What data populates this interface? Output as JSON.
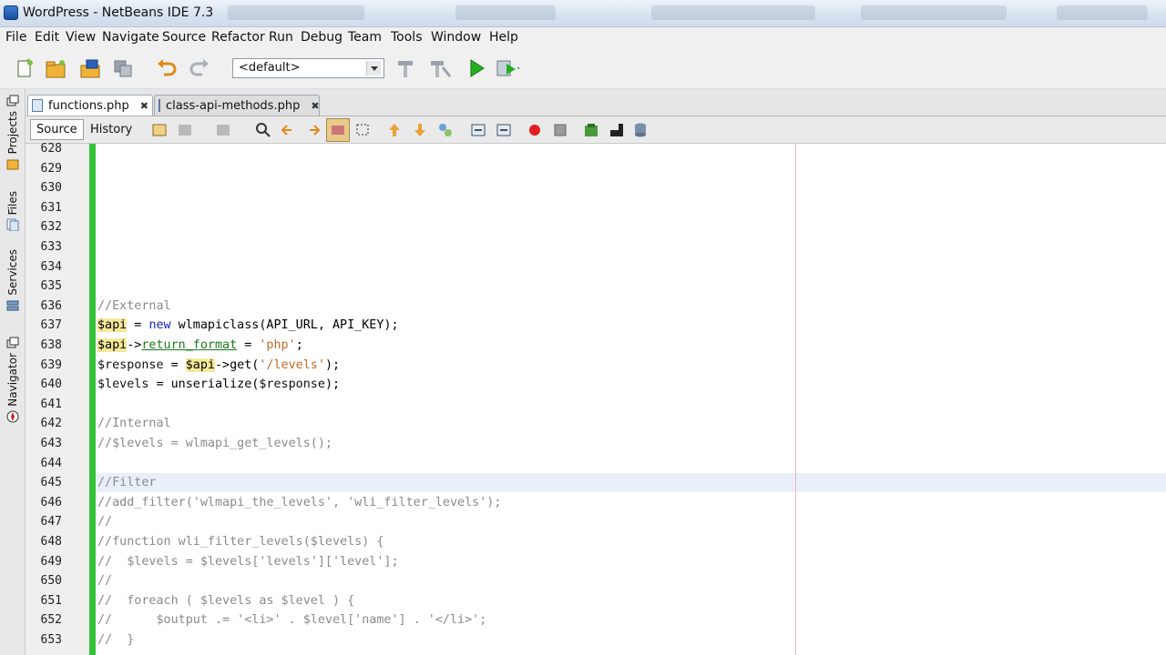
{
  "window": {
    "title": "WordPress - NetBeans IDE 7.3"
  },
  "menu": [
    "File",
    "Edit",
    "View",
    "Navigate",
    "Source",
    "Refactor",
    "Run",
    "Debug",
    "Team",
    "Tools",
    "Window",
    "Help"
  ],
  "toolbar": {
    "config_value": "<default>"
  },
  "side_panel": {
    "tabs": [
      "Projects",
      "Files",
      "Services",
      "Navigator"
    ]
  },
  "editor_tabs": [
    {
      "label": "functions.php",
      "close": "✖"
    },
    {
      "label": "class-api-methods.php",
      "close": "✖"
    }
  ],
  "editor_view": {
    "source_label": "Source",
    "history_label": "History"
  },
  "icons": {
    "colors": {
      "change_bar": "#33c23a",
      "run": "#22b022",
      "breakpoint": "#e02020"
    }
  },
  "code_lines": [
    {
      "num": "628",
      "text": ""
    },
    {
      "num": "629",
      "text": ""
    },
    {
      "num": "630",
      "text": ""
    },
    {
      "num": "631",
      "text": ""
    },
    {
      "num": "632",
      "text": ""
    },
    {
      "num": "633",
      "text": ""
    },
    {
      "num": "634",
      "text": ""
    },
    {
      "num": "635",
      "text": ""
    },
    {
      "num": "636",
      "text": "//External"
    },
    {
      "num": "637",
      "text": "$api = new wlmapiclass(API_URL, API_KEY);"
    },
    {
      "num": "638",
      "text": "$api->return_format = 'php';"
    },
    {
      "num": "639",
      "text": "$response = $api->get('/levels');"
    },
    {
      "num": "640",
      "text": "$levels = unserialize($response);"
    },
    {
      "num": "641",
      "text": ""
    },
    {
      "num": "642",
      "text": "//Internal"
    },
    {
      "num": "643",
      "text": "//$levels = wlmapi_get_levels();"
    },
    {
      "num": "644",
      "text": ""
    },
    {
      "num": "645",
      "text": "//Filter"
    },
    {
      "num": "646",
      "text": "//add_filter('wlmapi_the_levels', 'wli_filter_levels');"
    },
    {
      "num": "647",
      "text": "//"
    },
    {
      "num": "648",
      "text": "//function wli_filter_levels($levels) {"
    },
    {
      "num": "649",
      "text": "//  $levels = $levels['levels']['level'];"
    },
    {
      "num": "650",
      "text": "//"
    },
    {
      "num": "651",
      "text": "//  foreach ( $levels as $level ) {"
    },
    {
      "num": "652",
      "text": "//      $output .= '<li>' . $level['name'] . '</li>';"
    },
    {
      "num": "653",
      "text": "//  }"
    }
  ]
}
